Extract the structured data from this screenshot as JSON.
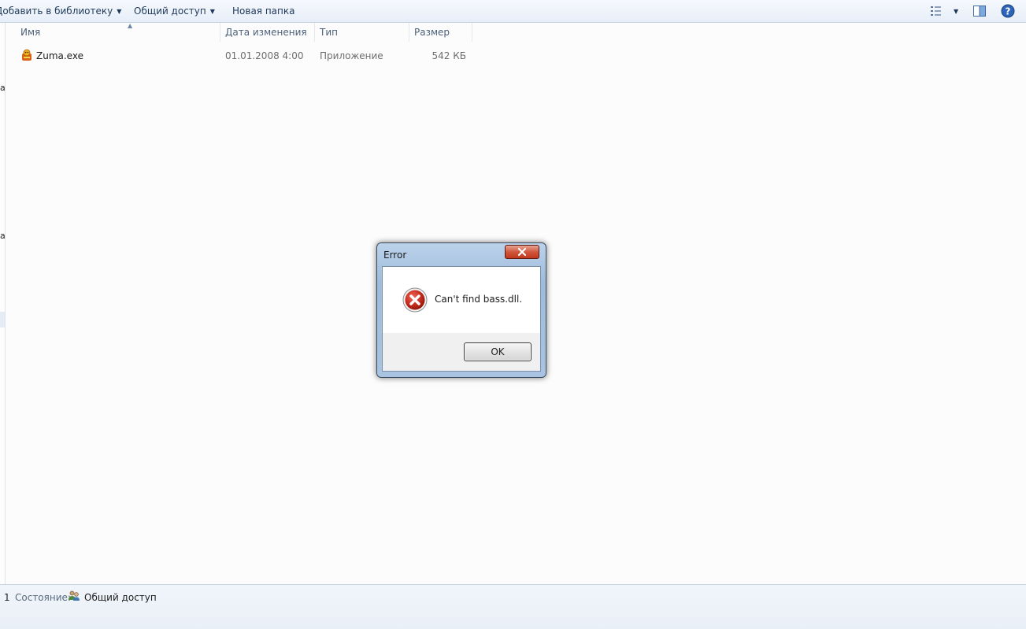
{
  "toolbar": {
    "add_to_library": "Добавить в библиотеку",
    "share": "Общий доступ",
    "new_folder": "Новая папка",
    "view_icon": "view-options-icon",
    "preview_icon": "preview-pane-icon",
    "help_icon": "help-icon"
  },
  "nav": {
    "fragment_1": "а",
    "fragment_2": "а"
  },
  "columns": {
    "name": "Имя",
    "date": "Дата изменения",
    "type": "Тип",
    "size": "Размер"
  },
  "files": [
    {
      "name": "Zuma.exe",
      "date": "01.01.2008 4:00",
      "type": "Приложение",
      "size": "542 КБ",
      "icon": "zuma-app-icon"
    }
  ],
  "status": {
    "count": "1",
    "state_label": "Состояние:",
    "state_value": "Общий доступ",
    "icon": "shared-users-icon"
  },
  "dialog": {
    "title": "Error",
    "message": "Can't find bass.dll.",
    "ok_label": "OK",
    "icon": "error-icon"
  },
  "colors": {
    "error_red": "#c42b1c",
    "toolbar_text": "#1e395b",
    "close_button": "#c1381d"
  }
}
